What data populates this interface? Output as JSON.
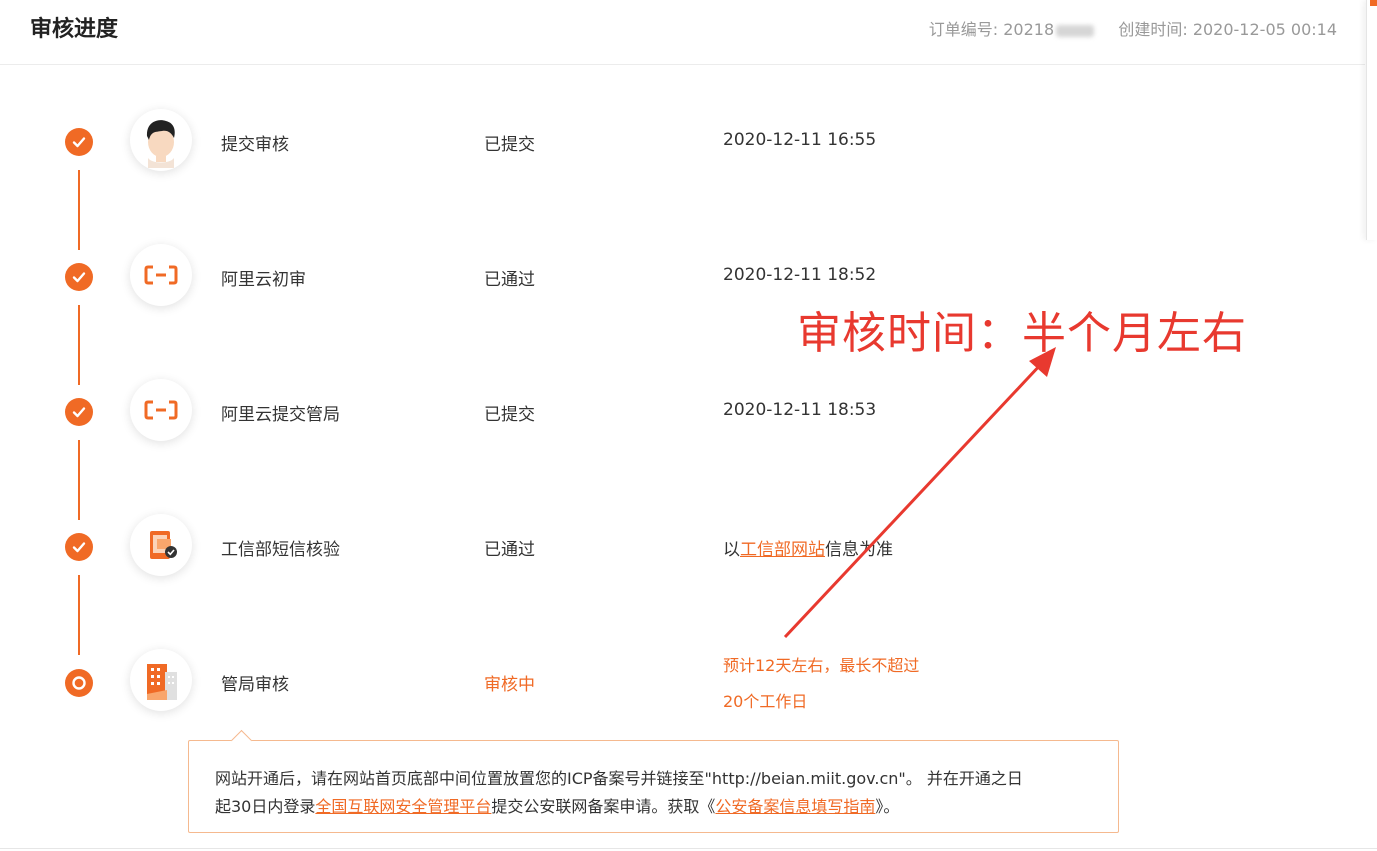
{
  "header": {
    "title": "审核进度",
    "order_label": "订单编号:",
    "order_number_visible": "20218",
    "created_label": "创建时间:",
    "created_time": "2020-12-05 00:14"
  },
  "steps": [
    {
      "name": "提交审核",
      "status": "已提交",
      "time": "2020-12-11 16:55",
      "icon": "user-avatar-icon",
      "done": true
    },
    {
      "name": "阿里云初审",
      "status": "已通过",
      "time": "2020-12-11 18:52",
      "icon": "aliyun-logo-icon",
      "done": true
    },
    {
      "name": "阿里云提交管局",
      "status": "已提交",
      "time": "2020-12-11 18:53",
      "icon": "aliyun-logo-icon",
      "done": true
    },
    {
      "name": "工信部短信核验",
      "status": "已通过",
      "icon": "sms-verify-icon",
      "done": true,
      "info": {
        "prefix": "以",
        "link": "工信部网站",
        "suffix": "信息为准"
      }
    },
    {
      "name": "管局审核",
      "status": "审核中",
      "icon": "building-icon",
      "done": false,
      "eta_line1": "预计12天左右，最长不超过",
      "eta_line2": "20个工作日"
    }
  ],
  "notice": {
    "line1": "网站开通后，请在网站首页底部中间位置放置您的ICP备案号并链接至\"http://beian.miit.gov.cn\"。 并在开通之日",
    "line2_prefix": "起30日内登录",
    "line2_link1": "全国互联网安全管理平台",
    "line2_mid": "提交公安联网备案申请。获取《",
    "line2_link2": "公安备案信息填写指南",
    "line2_suffix": "》。"
  },
  "annotation": {
    "text": "审核时间：半个月左右"
  },
  "colors": {
    "accent": "#f06a25",
    "annotation": "#e8392f"
  }
}
